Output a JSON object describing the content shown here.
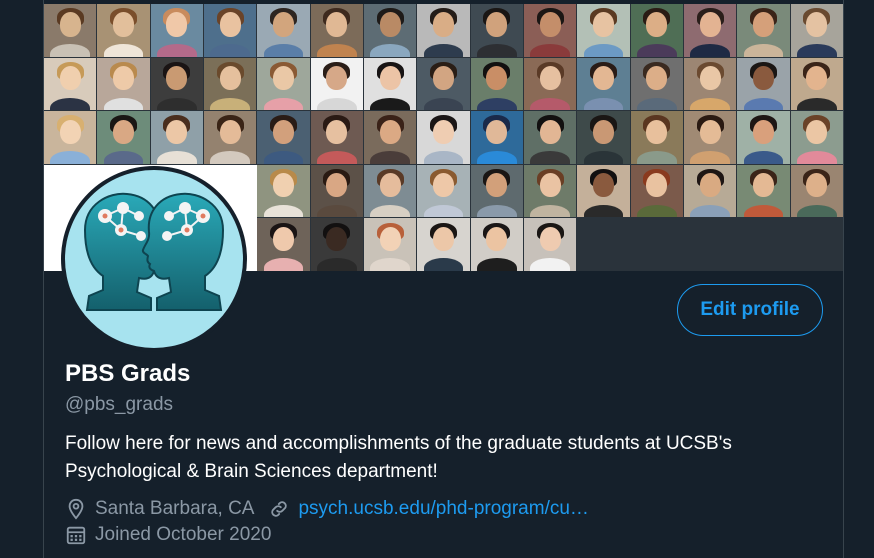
{
  "banner": {
    "tiles": [
      [
        "#8a7a6a",
        "#d7b48e",
        "#5a3a22",
        "#c9c1b5"
      ],
      [
        "#a89274",
        "#e2bf9b",
        "#7a4e2b",
        "#efe5d8"
      ],
      [
        "#6a8aa0",
        "#f0c8a8",
        "#c98b5d",
        "#b46a8a"
      ],
      [
        "#4e6f8c",
        "#e9c2a0",
        "#6a4328",
        "#4d6a8e"
      ],
      [
        "#9aa9b4",
        "#d2a57d",
        "#2d2520",
        "#5a7ea8"
      ],
      [
        "#7c6b59",
        "#e0b894",
        "#3e2a1e",
        "#c0834f"
      ],
      [
        "#5d6c74",
        "#b98a65",
        "#1e1a18",
        "#8aa7bf"
      ],
      [
        "#b9b9b9",
        "#d9ad86",
        "#241c18",
        "#2e3c4e"
      ],
      [
        "#3f4a52",
        "#d0a27c",
        "#1a1614",
        "#2d2f33"
      ],
      [
        "#8b5e56",
        "#c48e6a",
        "#1b1614",
        "#8a3b3b"
      ],
      [
        "#b3c0b6",
        "#e7c3a2",
        "#5a3a22",
        "#6c9ac4"
      ],
      [
        "#4f6e55",
        "#dcae86",
        "#2a1c14",
        "#4b3b5a"
      ],
      [
        "#8e6b70",
        "#e3b392",
        "#2a1e1a",
        "#1f2a44"
      ],
      [
        "#7a8a7a",
        "#d5a07a",
        "#3a2418",
        "#cbb59a"
      ],
      [
        "#a7a49b",
        "#e4c2a2",
        "#6a4a30",
        "#2a3a5a"
      ],
      [
        "#d8cbbb",
        "#f0cfae",
        "#c69a58",
        "#2b3344"
      ],
      [
        "#b8a79a",
        "#eecaa8",
        "#b98a4e",
        "#e0e0e0"
      ],
      [
        "#3d3d3d",
        "#c99a72",
        "#1a1414",
        "#2e2e2e"
      ],
      [
        "#7b6f58",
        "#e5c09d",
        "#6a4a2c",
        "#c8b079"
      ],
      [
        "#9ea79b",
        "#eac8a6",
        "#8a5a34",
        "#e6a0a8"
      ],
      [
        "#f2f2f2",
        "#d6a888",
        "#2a1e18",
        "#d7d7d7"
      ],
      [
        "#e0e0e0",
        "#ecc4a6",
        "#181414",
        "#1a1a1a"
      ],
      [
        "#4d5a64",
        "#d2a582",
        "#2a1e16",
        "#3a4452"
      ],
      [
        "#6a7e6a",
        "#c98e66",
        "#121010",
        "#2e3f63"
      ],
      [
        "#8a6a56",
        "#e6c0a0",
        "#5a3a26",
        "#b55a6a"
      ],
      [
        "#5e7f93",
        "#e3b793",
        "#2a1c16",
        "#7a90b0"
      ],
      [
        "#6f6f6f",
        "#dcae88",
        "#3a2a20",
        "#5a6a7a"
      ],
      [
        "#9c8673",
        "#e9c7a6",
        "#6b4a30",
        "#d7a76a"
      ],
      [
        "#9aa3a9",
        "#8a5a3e",
        "#1a1614",
        "#5a7ab0"
      ],
      [
        "#bfa98e",
        "#e3b48e",
        "#3a2418",
        "#2a2a2a"
      ],
      [
        "#c9b59c",
        "#f2d3b4",
        "#d8b070",
        "#8ab0d8"
      ],
      [
        "#6d8c7a",
        "#d9a884",
        "#1a1614",
        "#5a6a8a"
      ],
      [
        "#8fa0a8",
        "#ecc7a6",
        "#4a2e1e",
        "#e7e0d6"
      ],
      [
        "#94826f",
        "#e4bb98",
        "#3a2416",
        "#d3c9be"
      ],
      [
        "#4b6072",
        "#d2a07c",
        "#2a1c16",
        "#3d5a80"
      ],
      [
        "#6e5a52",
        "#e6c0a0",
        "#2a1a14",
        "#c45a5a"
      ],
      [
        "#7a6b5c",
        "#dba984",
        "#3a2218",
        "#4a3d3a"
      ],
      [
        "#d8d8d8",
        "#efcdb2",
        "#1a1616",
        "#a9b6c6"
      ],
      [
        "#2e6a9a",
        "#e0b898",
        "#1a2a4a",
        "#2a8ad8"
      ],
      [
        "#5f6f66",
        "#e2b694",
        "#121010",
        "#3a3a3a"
      ],
      [
        "#3e4a4a",
        "#c99874",
        "#1a1614",
        "#2a3438"
      ],
      [
        "#8a7a5a",
        "#e8c09c",
        "#5a3620",
        "#8a9a8a"
      ],
      [
        "#a08a74",
        "#e4bb96",
        "#2a1a12",
        "#d0a070"
      ],
      [
        "#9fb1a6",
        "#d9a07c",
        "#1e1614",
        "#3a5a8a"
      ],
      [
        "#8c9c8f",
        "#ebc6a4",
        "#6a4228",
        "#e28a9a"
      ],
      [
        "#7d7d73",
        "#d8ad8a",
        "#2a1e16",
        "#5a6a7a"
      ],
      [
        "#b09880",
        "#e5bd9a",
        "#7a4a2a",
        "#c89a6a"
      ],
      [
        "#6b4f44",
        "#ecc6a4",
        "#3a2218",
        "#d0b8a0"
      ],
      [
        "#a68b78",
        "#efc9aa",
        "#4a2c1c",
        "#b05a4a"
      ],
      [
        "#8f9480",
        "#f0d0b0",
        "#b88a4a",
        "#e8e2d8"
      ],
      [
        "#5c5148",
        "#d9a784",
        "#2a1a12",
        "#5a4a3e"
      ],
      [
        "#7e8c93",
        "#e5bc9c",
        "#5a3a26",
        "#d7cfc3"
      ],
      [
        "#a7b2b6",
        "#eec8a8",
        "#8a5a30",
        "#c0c8d6"
      ],
      [
        "#5e6a6e",
        "#d2a07a",
        "#1a1614",
        "#8a9aaa"
      ],
      [
        "#6e7b69",
        "#eac3a3",
        "#6a3e24",
        "#c0b4a0"
      ],
      [
        "#c4b09a",
        "#8a5a3e",
        "#121010",
        "#2a2a2a"
      ],
      [
        "#7b5a4b",
        "#e9c2a0",
        "#8a3a1e",
        "#5a6a3a"
      ],
      [
        "#b7aa96",
        "#d9aa82",
        "#1e1614",
        "#8aa0b8"
      ],
      [
        "#788a74",
        "#e4b994",
        "#3a2418",
        "#c05a3a"
      ],
      [
        "#9a8571",
        "#ddb08a",
        "#3a2418",
        "#4a6a5a"
      ],
      [
        "#c8bcae",
        "#e8c4a4",
        "#5a3a24",
        "#d4c8b6"
      ],
      [
        "#8f7f6d",
        "#e0b48e",
        "#1a1414",
        "#2e2e2e"
      ],
      [
        "#7a8f9e",
        "#eac6a6",
        "#5a3422",
        "#f0e8e0"
      ],
      [
        "#b1a38e",
        "#f0cdb0",
        "#c08a50",
        "#c0a888"
      ],
      [
        "#6e6359",
        "#efc9ac",
        "#1a1414",
        "#e7b0b0"
      ],
      [
        "#3a3a3a",
        "#3a2a22",
        "#121010",
        "#2a2a2a"
      ],
      [
        "#c9c2b8",
        "#f2d2b6",
        "#b8603a",
        "#e0d6cc"
      ],
      [
        "#d7d4cf",
        "#ecc7a8",
        "#1a1614",
        "#2a3a4a"
      ],
      [
        "#d1cdc7",
        "#ecc4a2",
        "#1a1616",
        "#1e1e1e"
      ],
      [
        "#c7c1ba",
        "#efcbb0",
        "#1a1614",
        "#f2f2f2"
      ]
    ]
  },
  "avatar": {
    "head_color": "#1c8a98",
    "head_dark": "#14606c",
    "node_color": "#f4f4f4",
    "node_accent": "#e07a5f"
  },
  "profile": {
    "edit_button_label": "Edit profile",
    "display_name": "PBS Grads",
    "handle": "@pbs_grads",
    "bio_line1": "Follow here for news and accomplishments of the graduate students at UCSB's",
    "bio_line2": "Psychological & Brain Sciences department!",
    "location": "Santa Barbara, CA",
    "website": "psych.ucsb.edu/phd-program/cu…",
    "joined": "Joined October 2020"
  },
  "icons": {
    "location": "location-pin-icon",
    "link": "link-icon",
    "calendar": "calendar-icon"
  },
  "colors": {
    "background": "#15202b",
    "accent": "#1d9bf0",
    "secondary_text": "#8b98a5",
    "avatar_bg": "#a7e3ef"
  }
}
